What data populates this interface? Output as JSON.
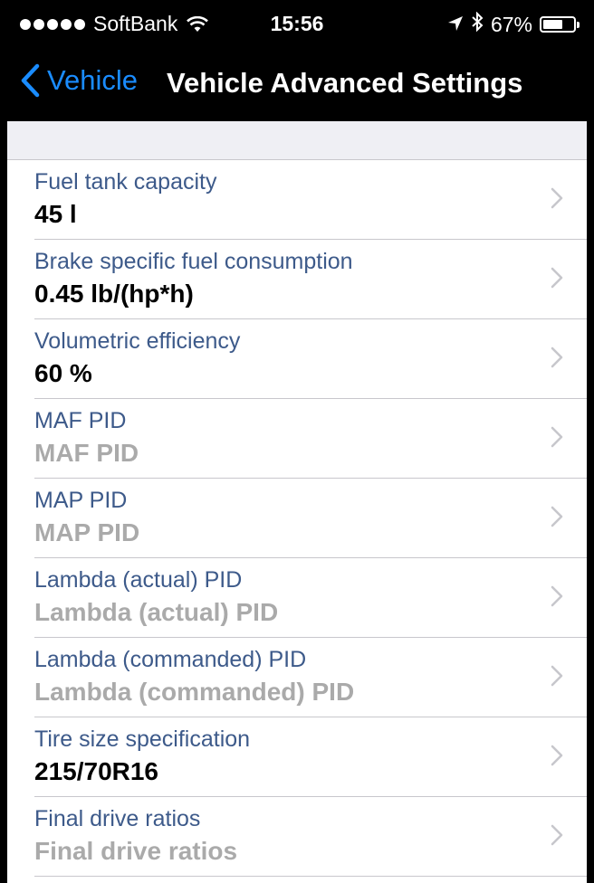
{
  "status_bar": {
    "carrier": "SoftBank",
    "time": "15:56",
    "battery_percent_label": "67%",
    "battery_level": 0.67,
    "icons": [
      "signal-dots",
      "wifi-icon",
      "location-arrow-icon",
      "bluetooth-icon",
      "battery-icon"
    ]
  },
  "nav": {
    "back_label": "Vehicle",
    "title": "Vehicle Advanced Settings",
    "accent_color": "#1a8cff"
  },
  "settings": [
    {
      "title": "Fuel tank capacity",
      "value": "45 l",
      "is_placeholder": false
    },
    {
      "title": "Brake specific fuel consumption",
      "value": "0.45 lb/(hp*h)",
      "is_placeholder": false
    },
    {
      "title": "Volumetric efficiency",
      "value": "60 %",
      "is_placeholder": false
    },
    {
      "title": "MAF PID",
      "value": "MAF PID",
      "is_placeholder": true
    },
    {
      "title": "MAP PID",
      "value": "MAP PID",
      "is_placeholder": true
    },
    {
      "title": "Lambda (actual) PID",
      "value": "Lambda (actual) PID",
      "is_placeholder": true
    },
    {
      "title": "Lambda (commanded) PID",
      "value": "Lambda (commanded) PID",
      "is_placeholder": true
    },
    {
      "title": "Tire size specification",
      "value": "215/70R16",
      "is_placeholder": false
    },
    {
      "title": "Final drive ratios",
      "value": "Final drive ratios",
      "is_placeholder": true
    }
  ]
}
